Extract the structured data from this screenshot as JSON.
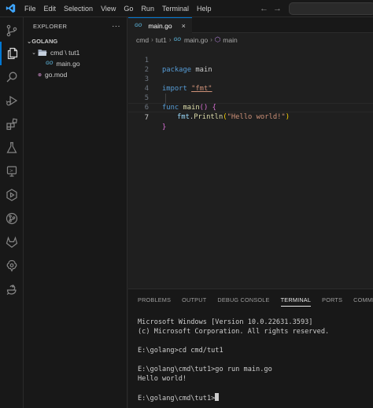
{
  "menu": [
    "File",
    "Edit",
    "Selection",
    "View",
    "Go",
    "Run",
    "Terminal",
    "Help"
  ],
  "nav": {
    "back_icon": "arrow-left-icon",
    "forward_icon": "arrow-right-icon"
  },
  "activity_bar": [
    "source-control-icon",
    "explorer-icon",
    "search-icon",
    "run-debug-icon",
    "extensions-icon",
    "testing-icon",
    "remote-explorer-icon",
    "deploy-icon",
    "git-graph-icon",
    "gitlab-icon",
    "kubernetes-icon",
    "docker-icon"
  ],
  "sidebar": {
    "title": "EXPLORER",
    "more": "···",
    "section": "GOLANG",
    "tree": [
      {
        "label": "cmd \\ tut1",
        "type": "folder",
        "expanded": true
      },
      {
        "label": "main.go",
        "type": "go-file"
      },
      {
        "label": "go.mod",
        "type": "mod-file"
      }
    ]
  },
  "tab": {
    "label": "main.go",
    "close": "×"
  },
  "breadcrumbs": [
    "cmd",
    "tut1",
    "main.go",
    "main"
  ],
  "code": {
    "line_numbers": [
      "1",
      "2",
      "3",
      "4",
      "5",
      "6",
      "7"
    ],
    "l1_kw": "package",
    "l1_id": "main",
    "l3_kw": "import",
    "l3_str": "\"fmt\"",
    "l5_kw": "func",
    "l5_fn": "main",
    "l5_paren": "()",
    "l5_brace": "{",
    "l6_pkg": "fmt",
    "l6_dot": ".",
    "l6_fn": "Println",
    "l6_open": "(",
    "l6_str": "\"Hello world!\"",
    "l6_close": ")",
    "l7_brace": "}"
  },
  "panel": {
    "tabs": [
      "PROBLEMS",
      "OUTPUT",
      "DEBUG CONSOLE",
      "TERMINAL",
      "PORTS",
      "COMMENTS"
    ],
    "active_tab": "TERMINAL"
  },
  "terminal": [
    "Microsoft Windows [Version 10.0.22631.3593]",
    "(c) Microsoft Corporation. All rights reserved.",
    "",
    "E:\\golang>cd cmd/tut1",
    "",
    "E:\\golang\\cmd\\tut1>go run main.go",
    "Hello world!",
    "",
    "E:\\golang\\cmd\\tut1>"
  ],
  "colors": {
    "accent": "#0078d4",
    "keyword": "#569cd6",
    "string": "#ce9178",
    "function": "#dcdcaa",
    "go_icon": "#519aba"
  }
}
